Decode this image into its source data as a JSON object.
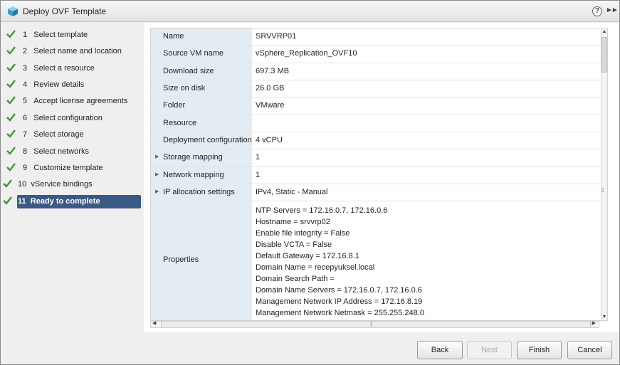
{
  "window": {
    "title": "Deploy OVF Template",
    "help_icon": "?",
    "expand_icon": "►►"
  },
  "colors": {
    "check": "#3a9a2c",
    "active_bg": "#3a5a86",
    "label_bg": "#e4ecf3"
  },
  "steps": [
    {
      "num": "1",
      "label": "Select template",
      "done": true
    },
    {
      "num": "2",
      "label": "Select name and location",
      "done": true
    },
    {
      "num": "3",
      "label": "Select a resource",
      "done": true
    },
    {
      "num": "4",
      "label": "Review details",
      "done": true
    },
    {
      "num": "5",
      "label": "Accept license agreements",
      "done": true
    },
    {
      "num": "6",
      "label": "Select configuration",
      "done": true
    },
    {
      "num": "7",
      "label": "Select storage",
      "done": true
    },
    {
      "num": "8",
      "label": "Select networks",
      "done": true
    },
    {
      "num": "9",
      "label": "Customize template",
      "done": true
    },
    {
      "num": "10",
      "label": "vService bindings",
      "done": true
    },
    {
      "num": "11",
      "label": "Ready to complete",
      "done": true,
      "active": true
    }
  ],
  "summary": {
    "name": {
      "label": "Name",
      "value": "SRVVRP01"
    },
    "source_vm": {
      "label": "Source VM name",
      "value": "vSphere_Replication_OVF10"
    },
    "download_size": {
      "label": "Download size",
      "value": "697.3 MB"
    },
    "disk_size": {
      "label": "Size on disk",
      "value": "26.0 GB"
    },
    "folder": {
      "label": "Folder",
      "value": "VMware"
    },
    "resource": {
      "label": "Resource",
      "value": ""
    },
    "deploy_config": {
      "label": "Deployment configuration",
      "value": "4 vCPU"
    },
    "storage_mapping": {
      "label": "Storage mapping",
      "value": "1"
    },
    "network_mapping": {
      "label": "Network mapping",
      "value": "1"
    },
    "ip_allocation": {
      "label": "IP allocation settings",
      "value": "IPv4, Static - Manual"
    },
    "properties": {
      "label": "Properties",
      "lines": [
        "NTP Servers = 172.16.0.7, 172.16.0.6",
        "Hostname = srvvrp02",
        "Enable file integrity = False",
        "Disable VCTA = False",
        "Default Gateway = 172.16.8.1",
        "Domain Name = recepyuksel.local",
        "Domain Search Path =",
        "Domain Name Servers = 172.16.0.7, 172.16.0.6",
        "Management Network IP Address = 172.16.8.19",
        "Management Network Netmask = 255.255.248.0"
      ]
    }
  },
  "buttons": {
    "back": "Back",
    "next": "Next",
    "finish": "Finish",
    "cancel": "Cancel"
  }
}
